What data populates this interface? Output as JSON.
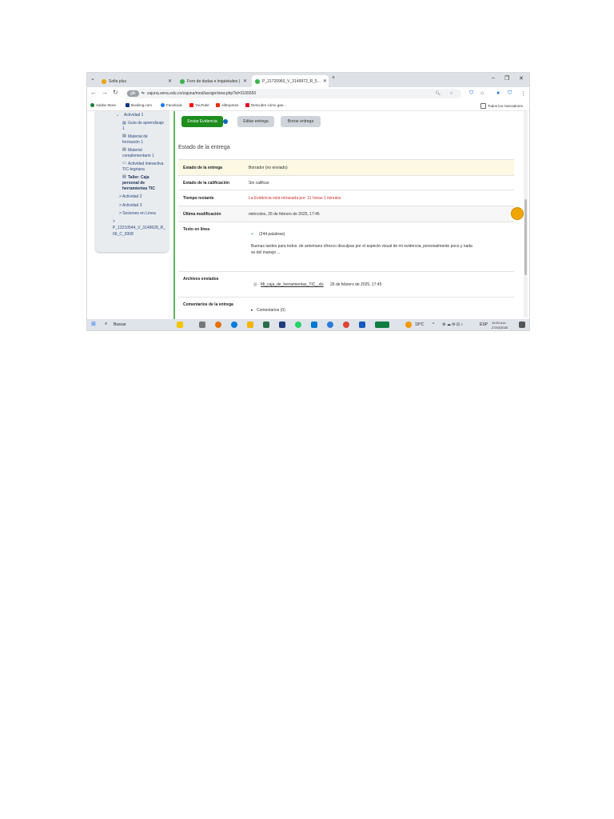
{
  "tabs": [
    {
      "label": "Sofia plus",
      "color": "#e8a400"
    },
    {
      "label": "Foro de dudas e inquietudes |",
      "color": "#39b54a"
    },
    {
      "label": "P_21720960_V_3149972_R_5...",
      "color": "#39b54a"
    }
  ],
  "browser": {
    "new_tab": "+",
    "url_chip": "gfk",
    "url": "zajuna.sena.edu.co/zajuna/mod/assign/view.php?id=3155550"
  },
  "bookmarks": [
    {
      "label": "Adobe Store",
      "color": "#1a7f37"
    },
    {
      "label": "Booking.com",
      "color": "#003580"
    },
    {
      "label": "Facebook",
      "color": "#1877f2"
    },
    {
      "label": "YouTube",
      "color": "#ff0000"
    },
    {
      "label": "AliExpress",
      "color": "#e62e04"
    },
    {
      "label": "Descubre cómo gan...",
      "color": "#e60023"
    }
  ],
  "all_bookmarks": "Todos los marcadores",
  "sidebar": {
    "items": [
      "Actividad 1",
      "Guía de aprendizaje",
      "1",
      "Material de",
      "formación 1",
      "Material",
      "complementario 1",
      "Actividad interactiva",
      "TIC-tegriana",
      "Taller: Caja",
      "personal de",
      "herramientas TIC",
      "> Actividad 2",
      "> Actividad 3",
      "> Sesiones en Línea",
      ">",
      "P_12210544_V_3149628_R_",
      "66_C_9308"
    ]
  },
  "actions": {
    "submit": "Enviar Evidencia",
    "edit": "Editar entrega",
    "delete": "Borrar entrega"
  },
  "status": {
    "title": "Estado de la entrega",
    "rows": [
      {
        "label": "Estado de la entrega",
        "value": "Borrador (no enviado)"
      },
      {
        "label": "Estado de la calificación",
        "value": "Sin calificar"
      },
      {
        "label": "Tiempo restante",
        "value": "La Evidencia está retrasada por: 11 horas 1 minutos"
      },
      {
        "label": "Última modificación",
        "value": "miércoles, 26 de febrero de 2025, 17:45"
      },
      {
        "label": "Texto en línea",
        "value": "(244 palabras)",
        "extra": "Buenas tardes para todos: de antemano ofrezco disculpas por el aspecto visual de mi evidencia, personalmente poco y nada",
        "extra2": "se del manejo ..."
      },
      {
        "label": "Archivos enviados",
        "value": "Mi_caja_de_herramientas_TIC_.xls",
        "extra": "26 de febrero de 2025, 17:45"
      },
      {
        "label": "Comentarios de la entrega",
        "value": "Comentarios (0)"
      }
    ]
  },
  "taskbar": {
    "search": "Buscar",
    "weather": "19°C",
    "lang": "ESP",
    "time": "11:00 a.m.",
    "date": "27/02/2025"
  },
  "colors": {
    "accent_green": "#1e8e1e",
    "warning_bg": "#fcf8e3",
    "late_red": "#c9302c"
  }
}
